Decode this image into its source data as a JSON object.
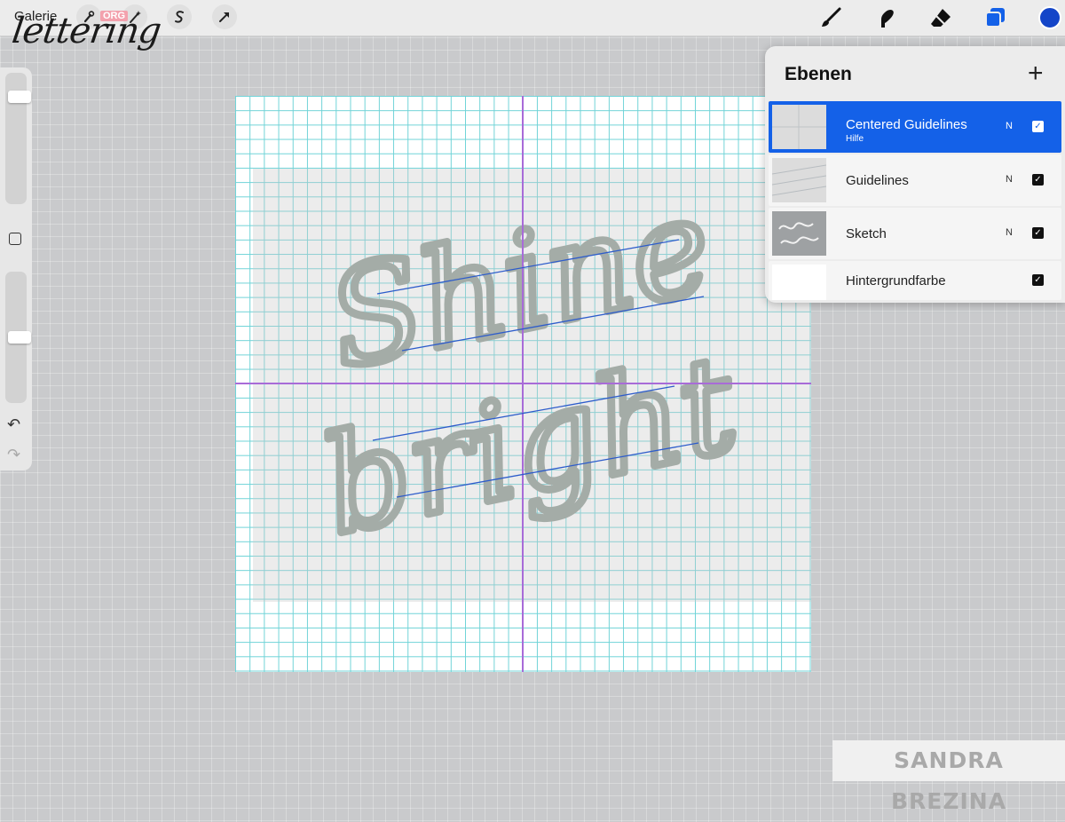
{
  "toolbar": {
    "gallery_label": "Galerie",
    "logo_text": "lettering",
    "logo_badge": "ORG",
    "left_tools": [
      "actions-wrench-icon",
      "adjustments-magic-wand-icon",
      "selection-s-icon",
      "transform-arrow-icon"
    ],
    "right_tools": [
      "brush-icon",
      "smudge-icon",
      "eraser-icon",
      "layers-icon"
    ],
    "current_color": "#1445c8"
  },
  "sidebar": {
    "size_slider_level": 0.85,
    "opacity_slider_level": 0.5,
    "modify_label": "",
    "undo_icon": "undo-icon",
    "redo_icon": "redo-icon"
  },
  "canvas": {
    "grid_color": "#6fd3d7",
    "centerline_color": "#a86bd8",
    "guideline_color": "#2d5ccb",
    "sketch_text_line1": "Shine",
    "sketch_text_line2": "bright"
  },
  "layers_panel": {
    "title": "Ebenen",
    "add_icon": "plus-icon",
    "layers": [
      {
        "name": "Centered Guidelines",
        "sub": "Hilfe",
        "mode": "N",
        "visible": true,
        "active": true
      },
      {
        "name": "Guidelines",
        "sub": "",
        "mode": "N",
        "visible": true,
        "active": false
      },
      {
        "name": "Sketch",
        "sub": "",
        "mode": "N",
        "visible": true,
        "active": false
      },
      {
        "name": "Hintergrundfarbe",
        "sub": "",
        "mode": "",
        "visible": true,
        "active": false
      }
    ]
  },
  "watermark": {
    "text": "SANDRA BREZINA"
  },
  "colors": {
    "accent": "#1461e8",
    "panel_bg": "#ececec"
  }
}
